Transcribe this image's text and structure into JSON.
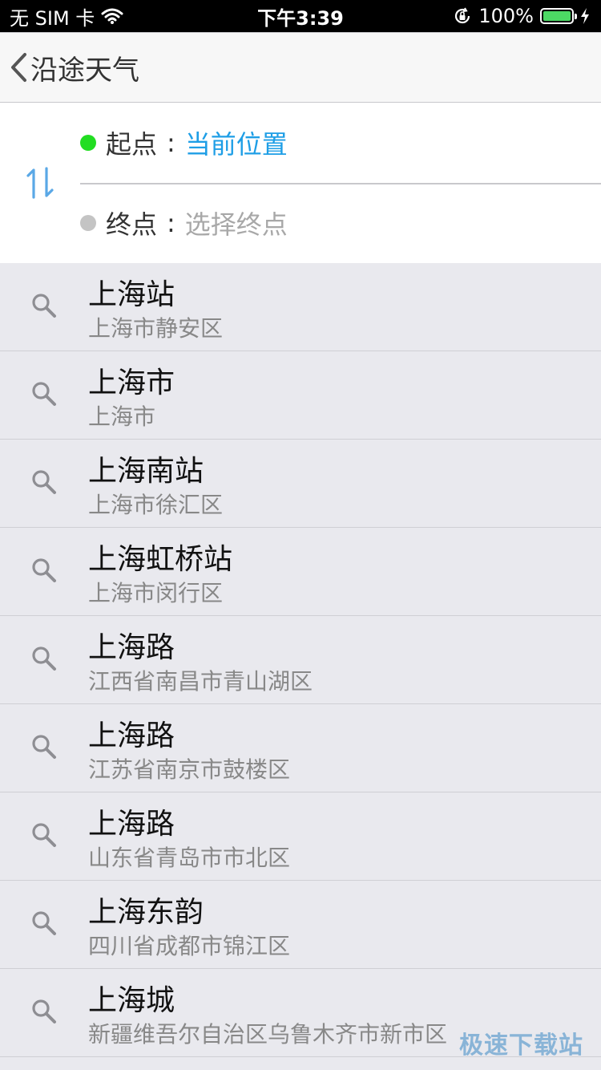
{
  "status_bar": {
    "carrier": "无 SIM 卡",
    "time": "下午3:39",
    "battery": "100%",
    "battery_level": 1.0,
    "icons": [
      "wifi-icon",
      "orientation-lock-icon",
      "battery-icon",
      "charging-bolt-icon"
    ]
  },
  "nav": {
    "back_icon": "chevron-left-icon",
    "title": "沿途天气"
  },
  "route": {
    "swap_icon": "swap-vertical-icon",
    "start_label": "起点",
    "start_value": "当前位置",
    "end_label": "终点",
    "end_value": "选择终点",
    "separator": ":",
    "start_dot_color": "#22dd22",
    "end_dot_color": "#c4c4c4"
  },
  "results": [
    {
      "name": "上海站",
      "address": "上海市静安区"
    },
    {
      "name": "上海市",
      "address": "上海市"
    },
    {
      "name": "上海南站",
      "address": "上海市徐汇区"
    },
    {
      "name": "上海虹桥站",
      "address": "上海市闵行区"
    },
    {
      "name": "上海路",
      "address": "江西省南昌市青山湖区"
    },
    {
      "name": "上海路",
      "address": "江苏省南京市鼓楼区"
    },
    {
      "name": "上海路",
      "address": "山东省青岛市市北区"
    },
    {
      "name": "上海东韵",
      "address": "四川省成都市锦江区"
    },
    {
      "name": "上海城",
      "address": "新疆维吾尔自治区乌鲁木齐市新市区"
    }
  ],
  "result_icon": "search-icon",
  "watermark": "极速下载站",
  "colors": {
    "accent": "#1e9ee6",
    "list_background": "#e9e9ee"
  }
}
